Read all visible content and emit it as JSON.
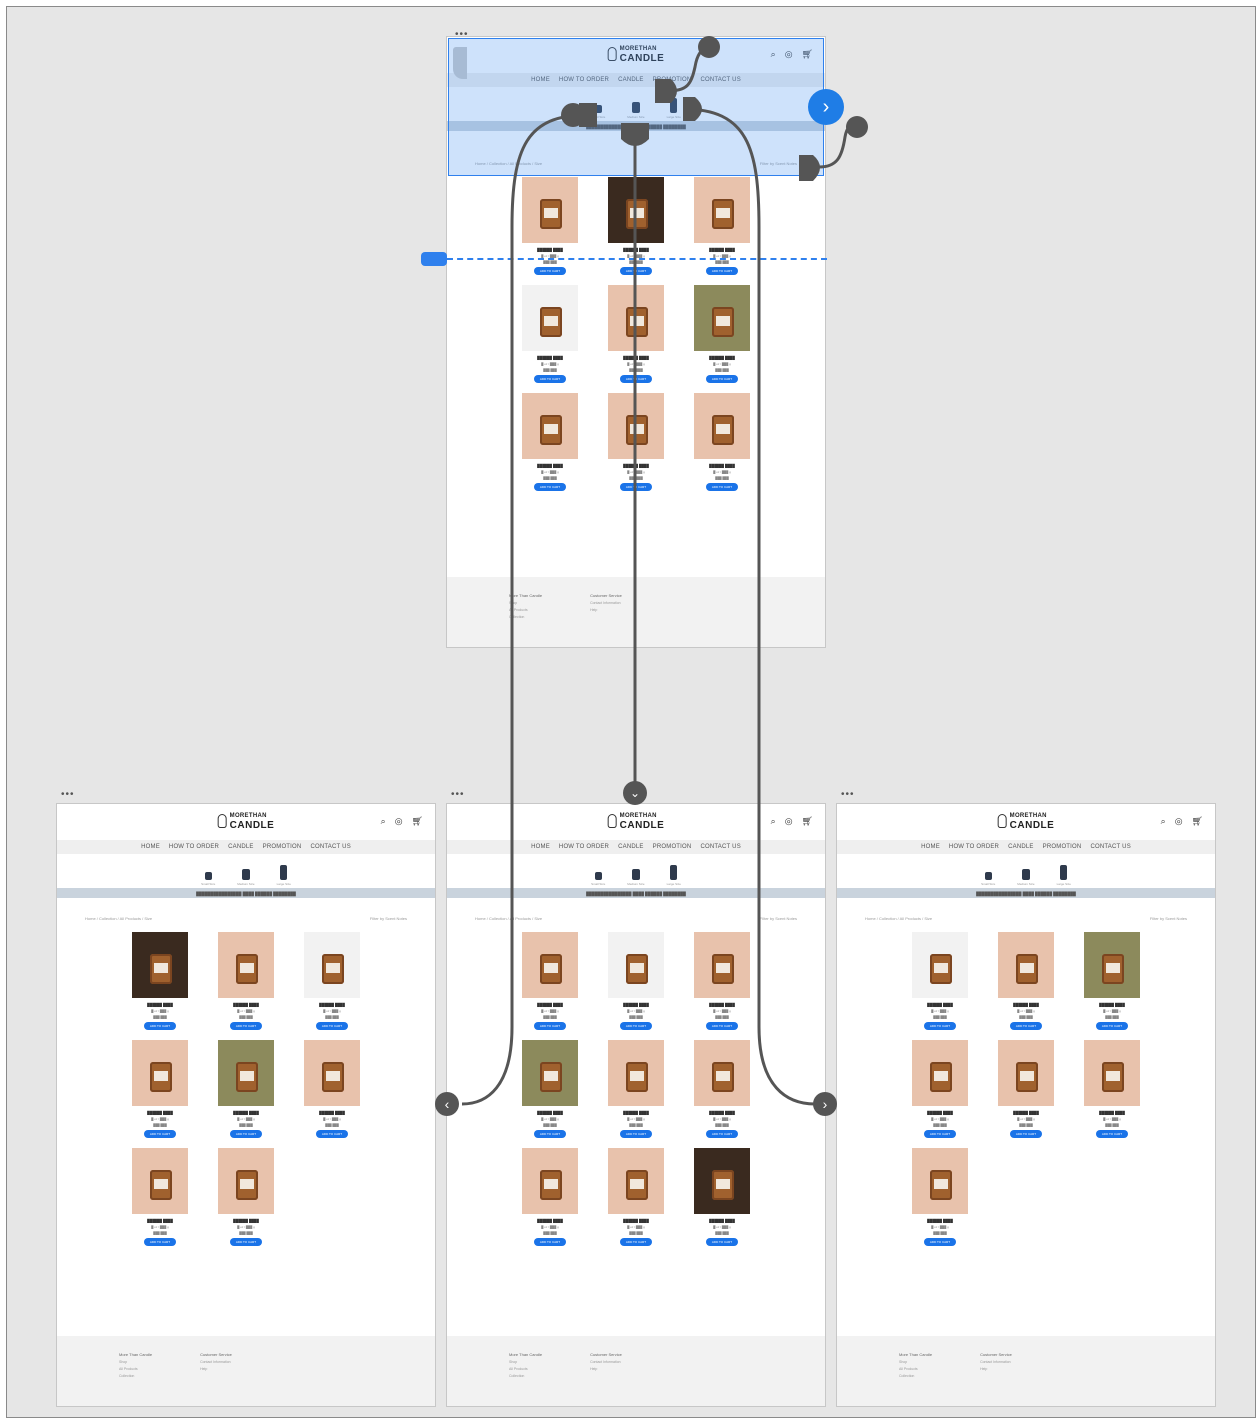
{
  "brand": {
    "line1": "MORETHAN",
    "line2": "CANDLE"
  },
  "nav": [
    "HOME",
    "HOW TO ORDER",
    "CANDLE",
    "PROMOTION",
    "CONTACT US"
  ],
  "header_icons": [
    "search-icon",
    "account-icon",
    "cart-icon"
  ],
  "categories": [
    {
      "label": "Small Size",
      "size": "small"
    },
    {
      "label": "Medium Size",
      "size": "medium"
    },
    {
      "label": "Large Size",
      "size": "large"
    }
  ],
  "banner_text": "████████████████ ████ ██████ ████████",
  "breadcrumb_text": "Home / Collection / All Products / Size",
  "filter_text": "Filter by Scent Notes",
  "product_placeholder": {
    "name": "██████ ████",
    "size": "█ oz / ███ g",
    "price": "███ ███",
    "button": "ADD TO CART"
  },
  "footer": {
    "col1": {
      "title": "More Than Candle",
      "links": [
        "Shop",
        "All Products",
        "Collection"
      ]
    },
    "col2": {
      "title": "Customer Service",
      "links": [
        "Contact Information",
        "Help"
      ]
    }
  },
  "artboards": {
    "top": {
      "products": 9
    },
    "small": {
      "products": 8
    },
    "medium": {
      "products": 9
    },
    "large": {
      "products": 7
    }
  },
  "accent_color": "#1a73e8",
  "selection_color": "#2f80ed",
  "wire_color": "#555555"
}
